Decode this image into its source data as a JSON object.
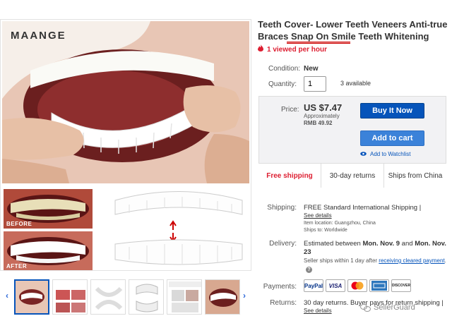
{
  "gallery": {
    "brand_logo": "MAANGE",
    "before_label": "BEFORE",
    "after_label": "AFTER"
  },
  "listing": {
    "title_part1": "Teeth Cover- Lower Teeth Veneers Anti-true Braces ",
    "title_highlight": "Snap On Smile",
    "title_part2": " Teeth Whitening",
    "watchers": "1 viewed per hour"
  },
  "condition": {
    "label": "Condition:",
    "value": "New"
  },
  "quantity": {
    "label": "Quantity:",
    "value": "1",
    "available": "3 available"
  },
  "price": {
    "label": "Price:",
    "value": "US $7.47",
    "approx_label": "Approximately",
    "approx_value": "RMB 49.92"
  },
  "actions": {
    "buy_now": "Buy It Now",
    "add_to_cart": "Add to cart",
    "watchlist": "Add to Watchlist"
  },
  "highlights": [
    "Free shipping",
    "30-day returns",
    "Ships from China"
  ],
  "shipping": {
    "label": "Shipping:",
    "text": "FREE  Standard International Shipping |",
    "details": "See details",
    "location": "Item location:  Guangzhou, China",
    "ships_to": "Ships to:  Worldwide"
  },
  "delivery": {
    "label": "Delivery:",
    "estimated_prefix": "Estimated between ",
    "date_start": "Mon. Nov. 9",
    "and": " and ",
    "date_end": "Mon. Nov. 23",
    "note_prefix": "Seller ships within 1 day after ",
    "note_link": "receiving cleared payment",
    "note_suffix": "."
  },
  "payments": {
    "label": "Payments:",
    "methods": [
      "PayPal",
      "VISA",
      "MasterCard",
      "AmEx",
      "DISCOVER"
    ]
  },
  "returns": {
    "label": "Returns:",
    "text": "30 day returns. Buyer pays for return shipping |",
    "details": "See details"
  },
  "watermark": "SellerGuard",
  "colors": {
    "primary_blue": "#0654ba",
    "cart_blue": "#3b82d9",
    "alert_red": "#dd1e31",
    "box_gray": "#f2f2f4"
  }
}
